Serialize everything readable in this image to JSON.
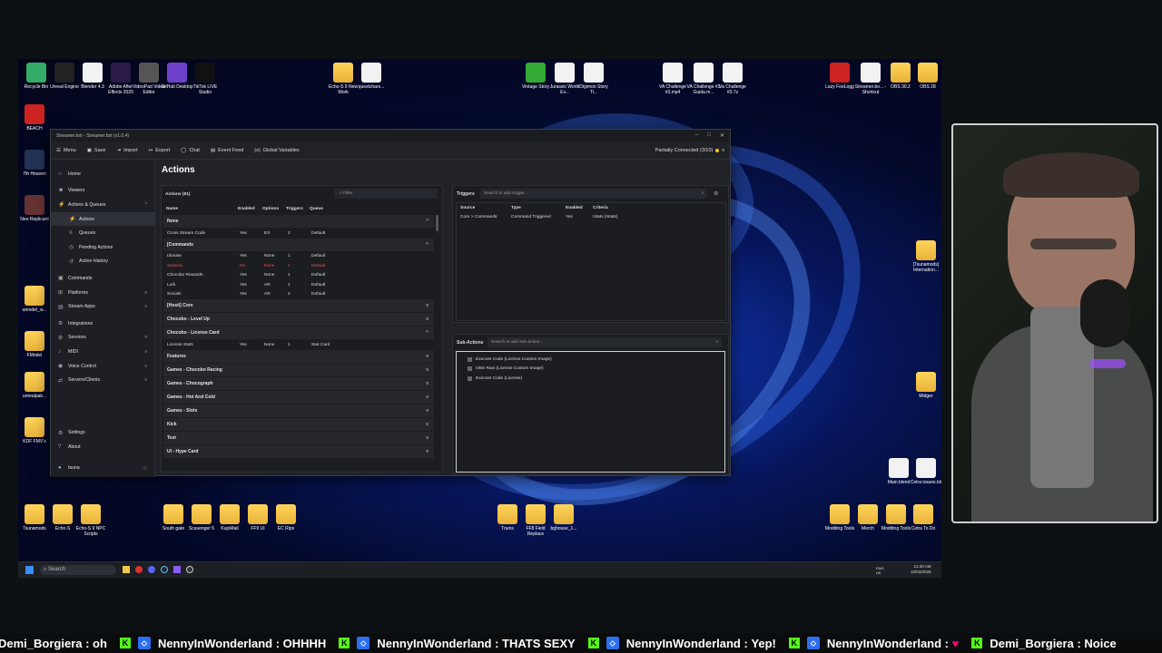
{
  "desktop": {
    "icons_top": [
      "Recycle Bin",
      "Unreal Engine",
      "Blender 4.3",
      "Adobe After Effects 2020",
      "VideoPad Video Editor",
      "GitHub Desktop",
      "TikTok LIVE Studio",
      "Echo-S 9 New Work",
      "questchars...",
      "Vintage Story",
      "Jurassic World Ev...",
      "Digimon Story Ti...",
      "VA Challenge #3.mp4",
      "VA Challenge #3 Guida.m...",
      "Va Challenge #3.7z",
      "Lazy FooLogg",
      "Streamer.bo... - Shortcut",
      "OBS 30.2",
      "OBS 28"
    ],
    "icons_left": [
      "BEACH",
      "7th Heaven",
      "Neo Replicant",
      "umodel_w...",
      "FModel",
      "unrealpak...",
      "KDF FMV's"
    ],
    "icons_right": [
      "[Tsunamods] Internation...",
      "Midger",
      "Main.blend",
      "Cetra issues.txt"
    ],
    "icons_bottom": [
      "Tsunamods",
      "Echo-S",
      "Echo-S 9 NPC Scripts",
      "South gate",
      "Scavenger 5",
      "KujoMail",
      "FF9 UI",
      "EC Rips",
      "Trains",
      "FF8 Field Replace",
      "bghouse_1...",
      "Modding Tools",
      "Merch",
      "Modding Tools",
      "Cetra To Do"
    ],
    "taskbar": {
      "search": "Search",
      "lang": "ENG UK",
      "time": "12:20 AM",
      "date": "10/03/2026"
    }
  },
  "window": {
    "title": "Streamer.bot - Streamer.bot (v1.0.4)",
    "menu": [
      "Menu",
      "Save",
      "Import",
      "Export",
      "Chat",
      "Event Feed",
      "Global Variables"
    ],
    "status": "Partially Connected (3/10)",
    "sidebar": [
      {
        "label": "Home",
        "icon": "⌂",
        "sub": false
      },
      {
        "label": "Viewers",
        "icon": "☻",
        "sub": false
      },
      {
        "label": "Actions & Queues",
        "icon": "⚡",
        "sub": false,
        "chev": "^"
      },
      {
        "label": "Actions",
        "icon": "⚡",
        "sub": true,
        "active": true
      },
      {
        "label": "Queues",
        "icon": "≡",
        "sub": true
      },
      {
        "label": "Pending Actions",
        "icon": "◷",
        "sub": true
      },
      {
        "label": "Action History",
        "icon": "↺",
        "sub": true
      },
      {
        "label": "Commands",
        "icon": "▣",
        "sub": false
      },
      {
        "label": "Platforms",
        "icon": "⊞",
        "sub": false,
        "chev": "v"
      },
      {
        "label": "Stream Apps",
        "icon": "▤",
        "sub": false,
        "chev": "v"
      },
      {
        "label": "Integrations",
        "icon": "⚙",
        "sub": false
      },
      {
        "label": "Services",
        "icon": "⚙",
        "sub": false,
        "chev": "v"
      },
      {
        "label": "MIDI",
        "icon": "♪",
        "sub": false,
        "chev": "v"
      },
      {
        "label": "Voice Control",
        "icon": "◉",
        "sub": false,
        "chev": "v"
      },
      {
        "label": "Servers/Clients",
        "icon": "⇄",
        "sub": false,
        "chev": "v"
      }
    ],
    "sidebar_bottom": [
      "Settings",
      "About",
      "tsuna"
    ],
    "page_title": "Actions",
    "actions_label": "Actions (81)",
    "filter_placeholder": "Filter",
    "columns": [
      "Name",
      "Enabled",
      "Options",
      "Triggers",
      "Queue"
    ],
    "groups": [
      {
        "name": "None",
        "open": true,
        "rows": [
          [
            "Cross Stream Code",
            "Yes",
            "EX",
            "2",
            "Default"
          ]
        ]
      },
      {
        "name": "[Commands",
        "open": true,
        "rows": [
          [
            "Idonate",
            "Yes",
            "None",
            "1",
            "Default"
          ],
          [
            "Seasoni",
            "No",
            "None",
            "1",
            "Default"
          ],
          [
            "Chocobo Rewards",
            "Yes",
            "None",
            "1",
            "Default"
          ],
          [
            "Lurk",
            "Yes",
            "AR",
            "1",
            "Default"
          ],
          [
            "Socials",
            "Yes",
            "AR",
            "2",
            "Default"
          ]
        ]
      },
      {
        "name": "[Hosti] Core",
        "open": false,
        "rows": []
      },
      {
        "name": "Chocobo - Level Up",
        "open": false,
        "rows": []
      },
      {
        "name": "Chocobo - License Card",
        "open": true,
        "rows": [
          [
            "License Stats",
            "Yes",
            "None",
            "1",
            "Stat Card"
          ]
        ]
      },
      {
        "name": "Features",
        "open": false,
        "rows": []
      },
      {
        "name": "Games - Chocobo Racing",
        "open": false,
        "rows": []
      },
      {
        "name": "Games - Chocograph",
        "open": false,
        "rows": []
      },
      {
        "name": "Games - Hot And Cold",
        "open": false,
        "rows": []
      },
      {
        "name": "Games - Slots",
        "open": false,
        "rows": []
      },
      {
        "name": "Kick",
        "open": false,
        "rows": []
      },
      {
        "name": "Test",
        "open": false,
        "rows": []
      },
      {
        "name": "UI - Hype Card",
        "open": false,
        "rows": []
      }
    ],
    "triggers": {
      "label": "Triggers",
      "search_placeholder": "Search to add trigger...",
      "columns": [
        "Source",
        "Type",
        "Enabled",
        "Criteria"
      ],
      "rows": [
        [
          "Core > Commands",
          "Command Triggered",
          "Yes",
          "!stats (!stats)"
        ]
      ]
    },
    "subactions": {
      "label": "Sub-Actions",
      "search_placeholder": "Search to add sub-action...",
      "items": [
        "Execute Code (Licence Custom Image)",
        "OBS Raw (License Custom Image)",
        "Execute Code (License)"
      ]
    }
  },
  "ticker": [
    {
      "user": "Demi_Borgiera",
      "msg": "oh",
      "badge": "kick"
    },
    {
      "user": "NennyInWonderland",
      "msg": "OHHHH",
      "badge": "twitch"
    },
    {
      "user": "NennyInWonderland",
      "msg": "THATS SEXY",
      "badge": "twitch"
    },
    {
      "user": "NennyInWonderland",
      "msg": "Yep!",
      "badge": "twitch"
    },
    {
      "user": "NennyInWonderland",
      "msg": "",
      "badge": "twitch"
    },
    {
      "user": "Demi_Borgiera",
      "msg": "Noice",
      "badge": "kick"
    }
  ],
  "ticker_text": {
    "u0": "Demi_Borgiera",
    "m0": "oh",
    "u1": "NennyInWonderland",
    "m1": "OHHHH",
    "u2": "NennyInWonderland",
    "m2": "THATS SEXY",
    "u3": "NennyInWonderland",
    "m3": "Yep!",
    "u4": "NennyInWonderland",
    "u5": "Demi_Borgiera",
    "m5": "Noice"
  }
}
